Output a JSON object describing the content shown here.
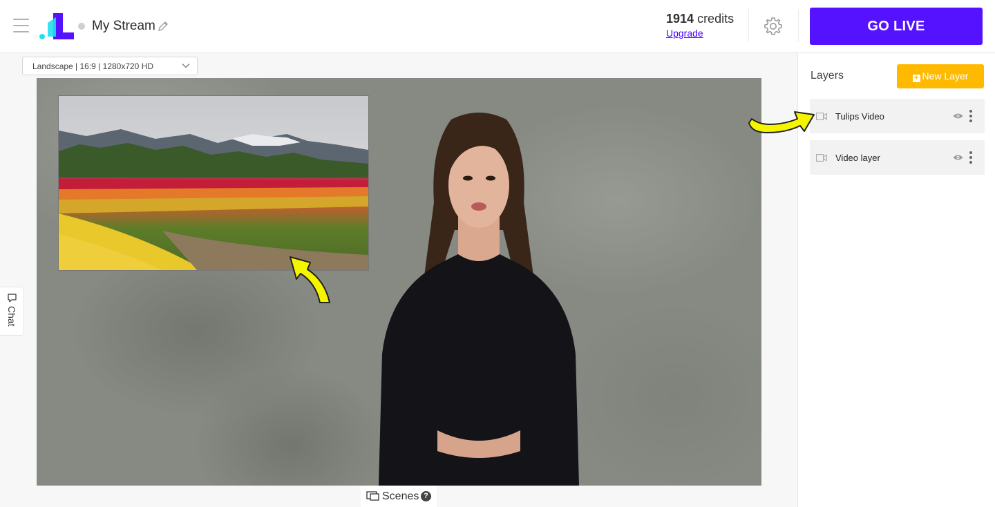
{
  "header": {
    "stream_title": "My Stream",
    "credits_value": "1914",
    "credits_unit": "credits",
    "upgrade_label": "Upgrade",
    "go_live_label": "GO LIVE"
  },
  "canvas": {
    "resolution_label": "Landscape | 16:9 | 1280x720 HD"
  },
  "chat": {
    "label": "Chat"
  },
  "scenes": {
    "label": "Scenes",
    "help": "?"
  },
  "layers": {
    "title": "Layers",
    "new_layer_label": "New Layer",
    "items": [
      {
        "name": "Tulips Video",
        "icon": "video-camera-icon"
      },
      {
        "name": "Video layer",
        "icon": "video-camera-icon"
      }
    ]
  },
  "colors": {
    "accent": "#5512ff",
    "new_layer": "#ffba00",
    "annotation_arrow": "#f5f500"
  }
}
